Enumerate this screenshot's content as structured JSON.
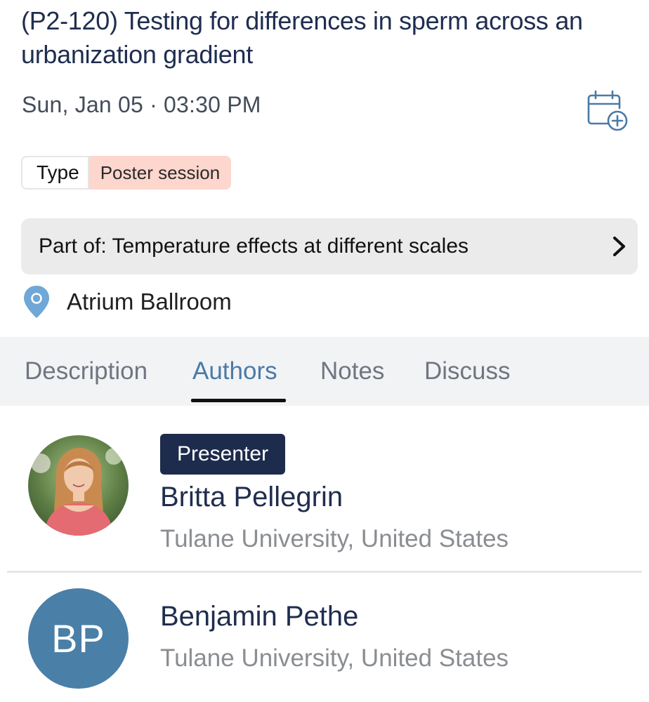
{
  "session": {
    "title": "(P2-120) Testing for differences in sperm across an urbanization gradient",
    "datetime": "Sun, Jan 05 · 03:30 PM",
    "add_to_calendar_icon": "calendar-plus-icon",
    "type_label": "Type",
    "type_value": "Poster session",
    "part_of": "Part of: Temperature effects at different scales",
    "location": "Atrium Ballroom"
  },
  "tabs": [
    {
      "label": "Description",
      "active": false
    },
    {
      "label": "Authors",
      "active": true
    },
    {
      "label": "Notes",
      "active": false
    },
    {
      "label": "Discuss",
      "active": false
    }
  ],
  "authors": [
    {
      "badge": "Presenter",
      "name": "Britta Pellegrin",
      "affiliation": "Tulane University, United States",
      "avatar": "photo"
    },
    {
      "initials": "BP",
      "name": "Benjamin Pethe",
      "affiliation": "Tulane University, United States",
      "avatar": "initials"
    }
  ],
  "colors": {
    "title": "#1f2d4f",
    "accent_tab": "#4b7aa6",
    "type_badge_bg": "#fdd6cd",
    "presenter_badge_bg": "#1d2b4c",
    "initials_avatar_bg": "#4a7fa8",
    "pin": "#6fa7d6"
  }
}
